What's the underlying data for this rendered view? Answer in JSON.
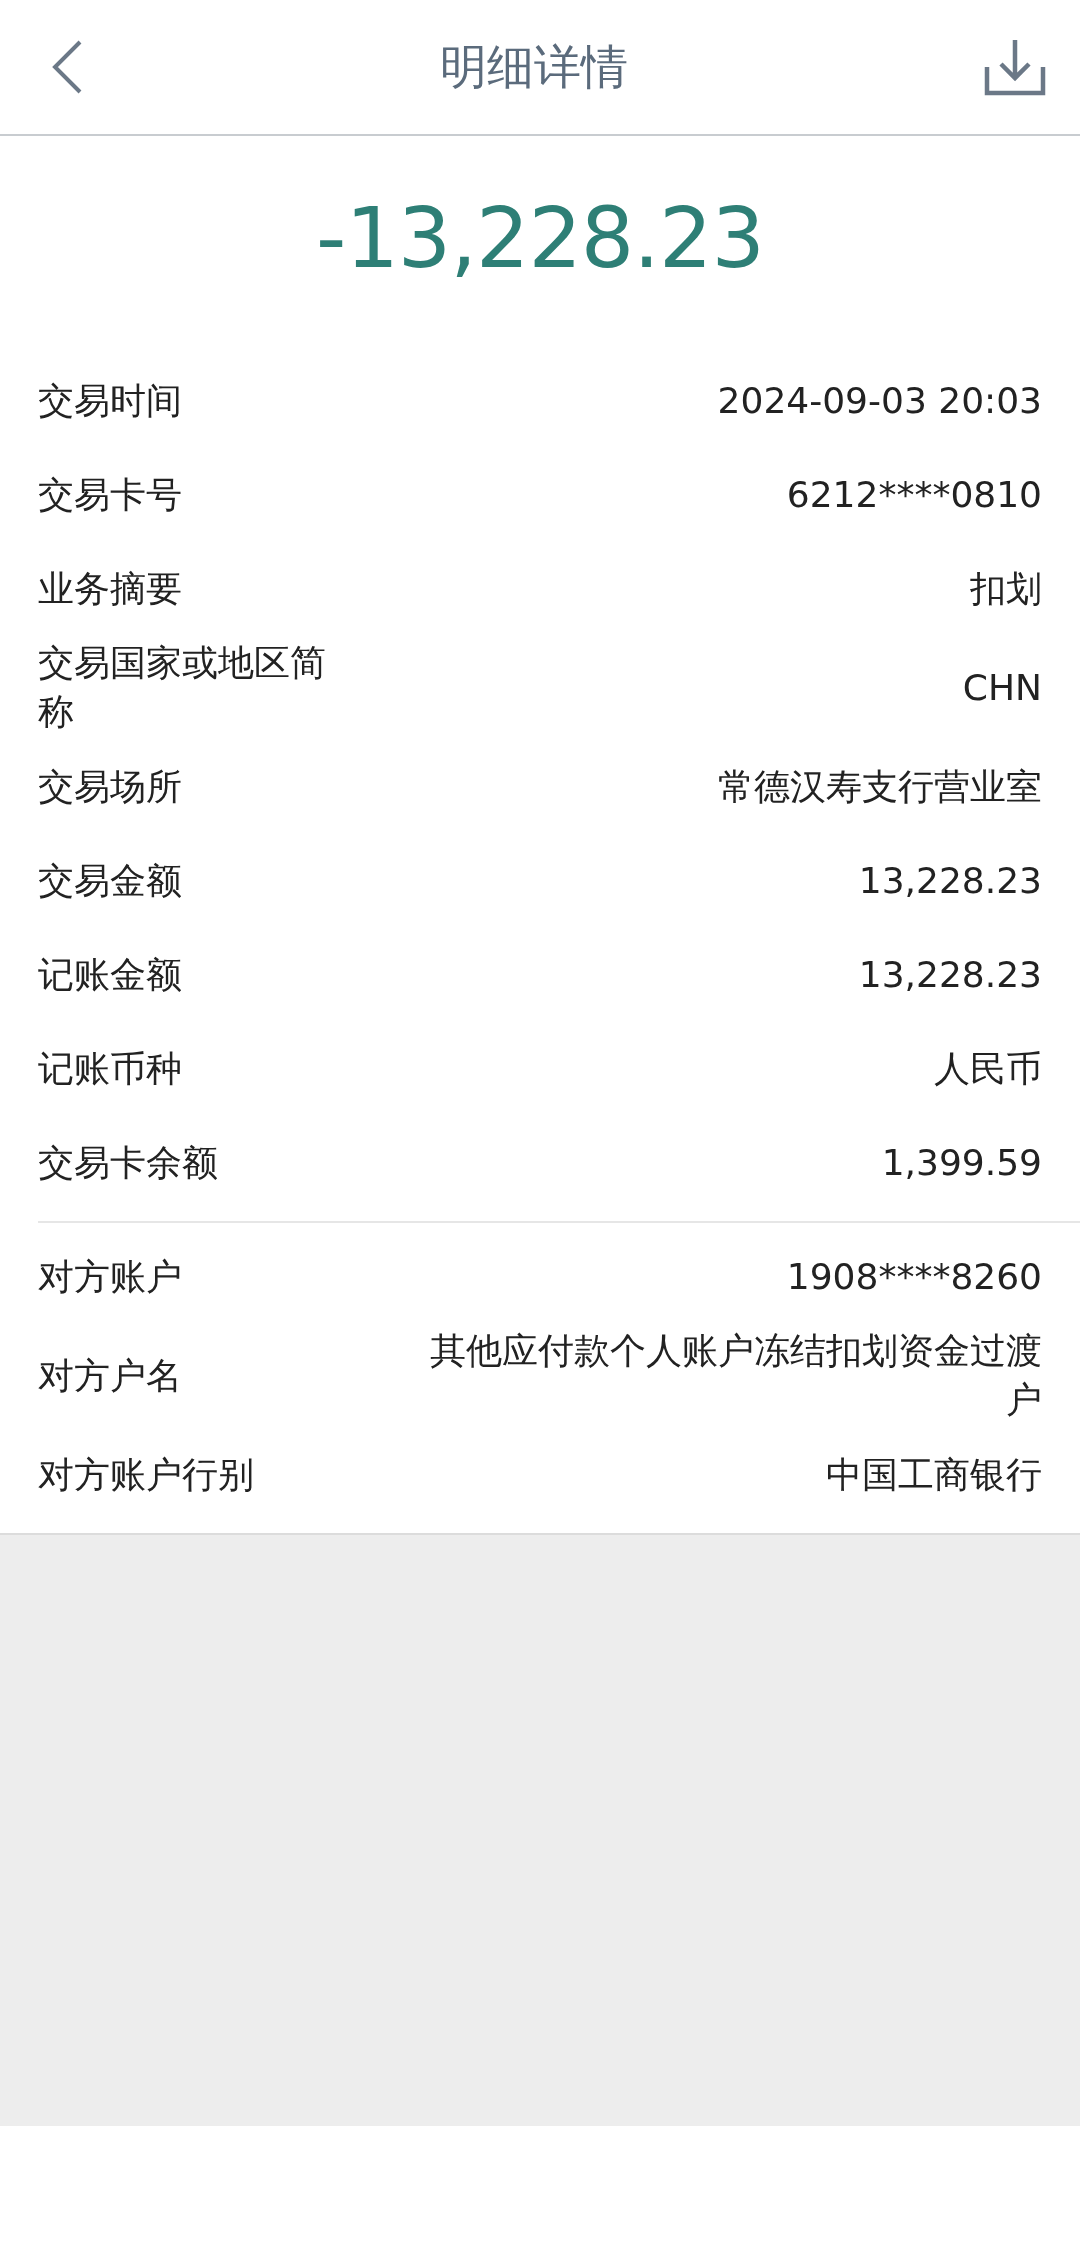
{
  "header": {
    "title": "明细详情"
  },
  "amount": "-13,228.23",
  "sections": [
    {
      "rows": [
        {
          "label": "交易时间",
          "value": "2024-09-03 20:03"
        },
        {
          "label": "交易卡号",
          "value": "6212****0810"
        },
        {
          "label": "业务摘要",
          "value": "扣划"
        },
        {
          "label": "交易国家或地区简称",
          "value": "CHN"
        },
        {
          "label": "交易场所",
          "value": "常德汉寿支行营业室"
        },
        {
          "label": "交易金额",
          "value": "13,228.23"
        },
        {
          "label": "记账金额",
          "value": "13,228.23"
        },
        {
          "label": "记账币种",
          "value": "人民币"
        },
        {
          "label": "交易卡余额",
          "value": "1,399.59"
        }
      ]
    },
    {
      "rows": [
        {
          "label": "对方账户",
          "value": "1908****8260"
        },
        {
          "label": "对方户名",
          "value": "其他应付款个人账户冻结扣划资金过渡户"
        },
        {
          "label": "对方账户行别",
          "value": "中国工商银行"
        }
      ]
    }
  ]
}
